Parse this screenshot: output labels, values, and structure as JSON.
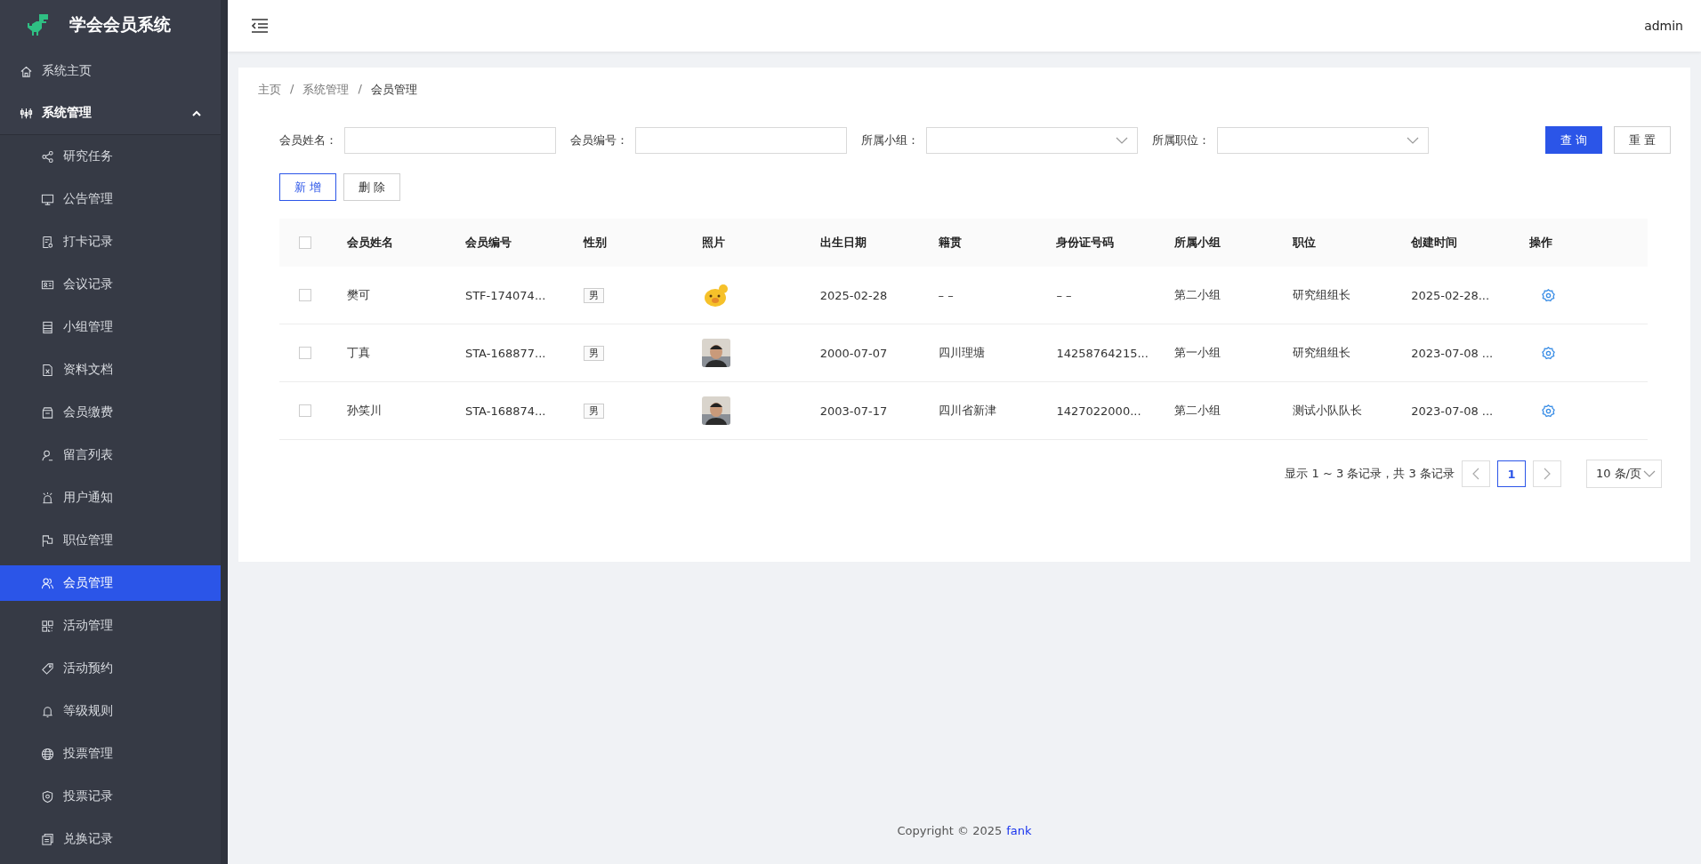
{
  "app": {
    "title": "学会会员系统"
  },
  "sidebar": {
    "items": [
      {
        "label": "系统主页",
        "selected": false
      },
      {
        "label": "系统管理",
        "selected": false,
        "expanded": true,
        "children": [
          {
            "label": "研究任务",
            "selected": false
          },
          {
            "label": "公告管理",
            "selected": false
          },
          {
            "label": "打卡记录",
            "selected": false
          },
          {
            "label": "会议记录",
            "selected": false
          },
          {
            "label": "小组管理",
            "selected": false
          },
          {
            "label": "资料文档",
            "selected": false
          },
          {
            "label": "会员缴费",
            "selected": false
          },
          {
            "label": "留言列表",
            "selected": false
          },
          {
            "label": "用户通知",
            "selected": false
          },
          {
            "label": "职位管理",
            "selected": false
          },
          {
            "label": "会员管理",
            "selected": true
          },
          {
            "label": "活动管理",
            "selected": false
          },
          {
            "label": "活动预约",
            "selected": false
          },
          {
            "label": "等级规则",
            "selected": false
          },
          {
            "label": "投票管理",
            "selected": false
          },
          {
            "label": "投票记录",
            "selected": false
          },
          {
            "label": "兑换记录",
            "selected": false
          }
        ]
      }
    ]
  },
  "header": {
    "user": "admin"
  },
  "breadcrumb": [
    {
      "label": "主页"
    },
    {
      "separator": "/",
      "label": "系统管理"
    },
    {
      "separator": "/",
      "label": "会员管理"
    }
  ],
  "filters": [
    {
      "label": "会员姓名：",
      "kind": "input"
    },
    {
      "label": "会员编号：",
      "kind": "input"
    },
    {
      "label": "所属小组：",
      "kind": "select"
    },
    {
      "label": "所属职位：",
      "kind": "select"
    }
  ],
  "filter_buttons": [
    {
      "label": "查 询",
      "kind": "primary"
    },
    {
      "label": "重 置",
      "kind": "default"
    }
  ],
  "actions": [
    {
      "label": "新 增",
      "kind": "outline"
    },
    {
      "label": "删 除",
      "kind": "default"
    }
  ],
  "table": {
    "header_checked": false,
    "columns": [
      "会员姓名",
      "会员编号",
      "性别",
      "照片",
      "出生日期",
      "籍贯",
      "身份证号码",
      "所属小组",
      "职位",
      "创建时间",
      "操作"
    ],
    "rows": [
      {
        "checked": false,
        "name": "樊可",
        "number": "STF-174074...",
        "gender": "男",
        "birth": "2025-02-28",
        "origin": "– –",
        "id_card": "– –",
        "group": "第二小组",
        "position": "研究组组长",
        "created": "2025-02-28..."
      },
      {
        "checked": false,
        "name": "丁真",
        "number": "STA-168877...",
        "gender": "男",
        "birth": "2000-07-07",
        "origin": "四川理塘",
        "id_card": "14258764215...",
        "group": "第一小组",
        "position": "研究组组长",
        "created": "2023-07-08 ..."
      },
      {
        "checked": false,
        "name": "孙笑川",
        "number": "STA-168874...",
        "gender": "男",
        "birth": "2003-07-17",
        "origin": "四川省新津",
        "id_card": "1427022000...",
        "group": "第二小组",
        "position": "测试小队队长",
        "created": "2023-07-08 ..."
      }
    ]
  },
  "pagination": {
    "summary": "显示 1 ~ 3 条记录，共 3 条记录",
    "pages": [
      {
        "label": "1",
        "selected": true
      }
    ],
    "page_size": "10 条/页"
  },
  "footer": {
    "text": "Copyright © 2025",
    "link": "fank"
  }
}
